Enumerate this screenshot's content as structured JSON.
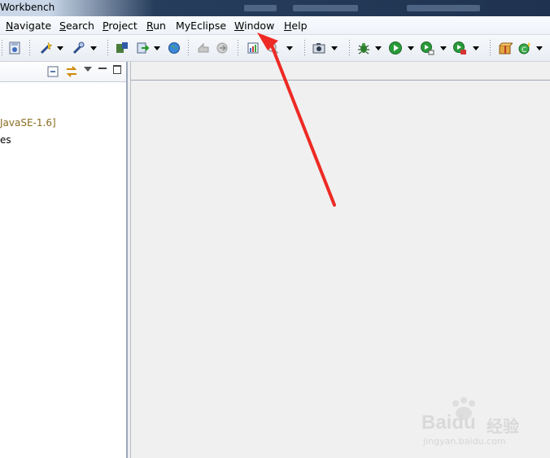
{
  "window": {
    "title": "Workbench"
  },
  "menu": [
    {
      "pre": "",
      "u": "N",
      "post": "avigate",
      "name": "menu-navigate"
    },
    {
      "pre": "",
      "u": "S",
      "post": "earch",
      "name": "menu-search"
    },
    {
      "pre": "",
      "u": "P",
      "post": "roject",
      "name": "menu-project"
    },
    {
      "pre": "",
      "u": "R",
      "post": "un",
      "name": "menu-run"
    },
    {
      "pre": "MyEclipse",
      "u": "",
      "post": "",
      "name": "menu-myeclipse"
    },
    {
      "pre": "",
      "u": "W",
      "post": "indow",
      "name": "menu-window"
    },
    {
      "pre": "",
      "u": "H",
      "post": "elp",
      "name": "menu-help"
    }
  ],
  "package_explorer": {
    "jre_label": "JavaSE-1.6]",
    "truncated_item": "es"
  },
  "watermark": {
    "brand": "Baidu",
    "cn": "经验",
    "url": "jingyan.baidu.com"
  },
  "colors": {
    "arrow": "#ee2a24",
    "jre_text": "#8a6d1f",
    "view_border": "#9aa8bb"
  }
}
